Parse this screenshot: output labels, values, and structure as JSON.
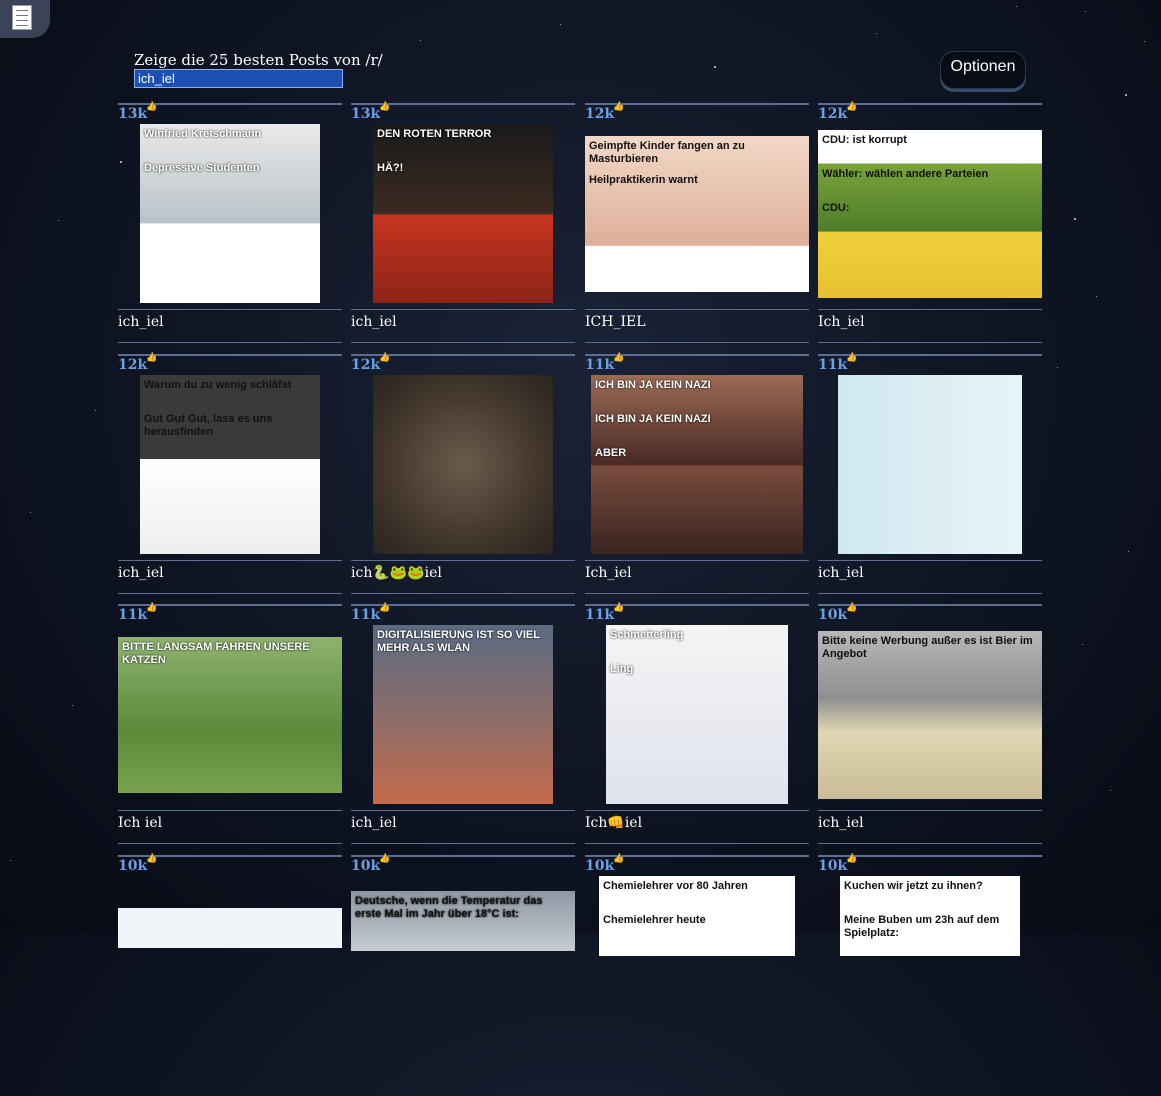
{
  "header": {
    "label": "Zeige die 25 besten Posts von /r/",
    "subreddit": "ich_iel",
    "options_label": "Optionen"
  },
  "posts": [
    {
      "score": "13k",
      "title": "ich_iel",
      "image": "Kretschmann meme",
      "caption_1": "Winfried Kretschmann",
      "caption_2": "Depressive Studenten"
    },
    {
      "score": "13k",
      "title": "ich_iel",
      "image": "Die PARTEI poster",
      "caption_1": "DEN ROTEN TERROR",
      "caption_2": "HÄ?!"
    },
    {
      "score": "12k",
      "title": "ICH_IEL",
      "image": "Vaccination news",
      "caption_1": "Geimpfte Kinder fangen an zu Masturbieren",
      "caption_2": "Heilpraktikerin warnt"
    },
    {
      "score": "12k",
      "title": "Ich_iel",
      "image": "Surprised Pikachu",
      "caption_1": "CDU: ist korrupt",
      "caption_2": "Wähler: wählen andere Parteien",
      "caption_3": "CDU:"
    },
    {
      "score": "12k",
      "title": "ich_iel",
      "image": "Sleep video meme",
      "caption_1": "Warum du zu wenig schläfst",
      "caption_2": "Gut Gut Gut, lass es uns herausfinden"
    },
    {
      "score": "12k",
      "title": "ich🐍🐸🐸iel",
      "image": "Snake photo"
    },
    {
      "score": "11k",
      "title": "Ich_iel",
      "image": "Darth Maul meme",
      "caption_1": "ICH BIN JA KEIN NAZI",
      "caption_2": "ICH BIN JA KEIN NAZI",
      "caption_3": "ABER"
    },
    {
      "score": "11k",
      "title": "ich_iel",
      "image": "Flags comic"
    },
    {
      "score": "11k",
      "title": "Ich iel",
      "image": "Slow down sign",
      "caption_1": "BITTE LANGSAM FAHREN UNSERE KATZEN"
    },
    {
      "score": "11k",
      "title": "ich_iel",
      "image": "Election poster",
      "caption_1": "DIGITALISIERUNG IST SO VIEL MEHR ALS WLAN"
    },
    {
      "score": "11k",
      "title": "Ich👊iel",
      "image": "Anime meme",
      "caption_1": "Schmetterling",
      "caption_2": "Ling"
    },
    {
      "score": "10k",
      "title": "ich_iel",
      "image": "Mailbox",
      "caption_1": "Bitte keine Werbung außer es ist Bier im Angebot"
    },
    {
      "score": "10k",
      "title": "",
      "image": "Translator"
    },
    {
      "score": "10k",
      "title": "",
      "image": "Temperature meme",
      "caption_1": "Deutsche, wenn die Temperatur das erste Mal im Jahr über 18°C ist:"
    },
    {
      "score": "10k",
      "title": "",
      "image": "Chemistry teacher",
      "caption_1": "Chemielehrer vor 80 Jahren",
      "caption_2": "Chemielehrer heute"
    },
    {
      "score": "10k",
      "title": "",
      "image": "Playground meme",
      "caption_1": "Kuchen wir jetzt zu ihnen?",
      "caption_2": "Meine Buben um 23h auf dem Spielplatz:"
    }
  ]
}
